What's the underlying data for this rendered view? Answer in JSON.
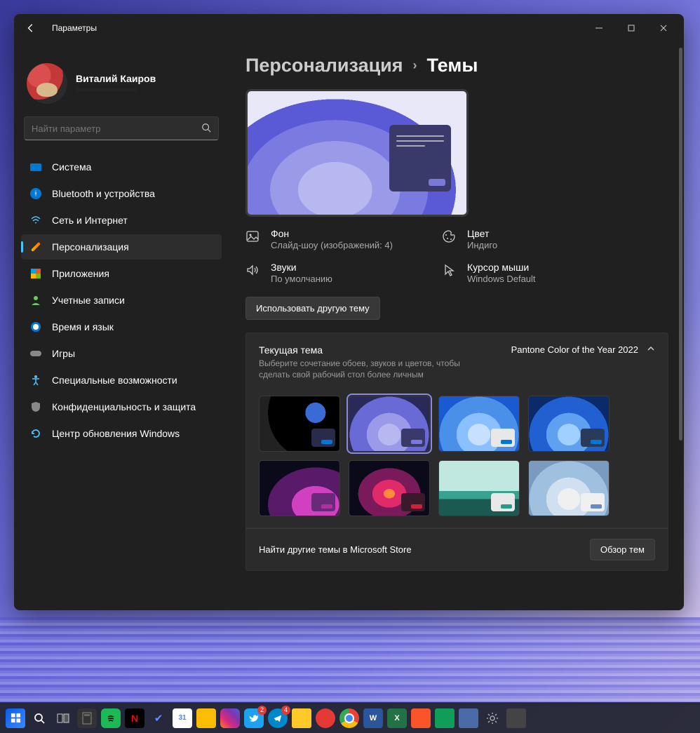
{
  "window": {
    "title": "Параметры"
  },
  "profile": {
    "name": "Виталий Каиров",
    "email": "························"
  },
  "search": {
    "placeholder": "Найти параметр"
  },
  "nav": {
    "system": "Система",
    "bluetooth": "Bluetooth и устройства",
    "network": "Сеть и Интернет",
    "personalization": "Персонализация",
    "apps": "Приложения",
    "accounts": "Учетные записи",
    "time": "Время и язык",
    "gaming": "Игры",
    "accessibility": "Специальные возможности",
    "privacy": "Конфиденциальность и защита",
    "update": "Центр обновления Windows"
  },
  "breadcrumb": {
    "parent": "Персонализация",
    "current": "Темы"
  },
  "options": {
    "background": {
      "title": "Фон",
      "value": "Слайд-шоу (изображений: 4)"
    },
    "color": {
      "title": "Цвет",
      "value": "Индиго"
    },
    "sounds": {
      "title": "Звуки",
      "value": "По умолчанию"
    },
    "cursor": {
      "title": "Курсор мыши",
      "value": "Windows Default"
    }
  },
  "use_other_theme": "Использовать другую тему",
  "current_theme": {
    "title": "Текущая тема",
    "subtitle": "Выберите сочетание обоев, звуков и цветов, чтобы сделать свой рабочий стол более личным",
    "selected": "Pantone Color of the Year 2022"
  },
  "store": {
    "text": "Найти другие темы в Microsoft Store",
    "button": "Обзор тем"
  },
  "taskbar_badges": {
    "twitter": "2",
    "telegram": "4"
  }
}
